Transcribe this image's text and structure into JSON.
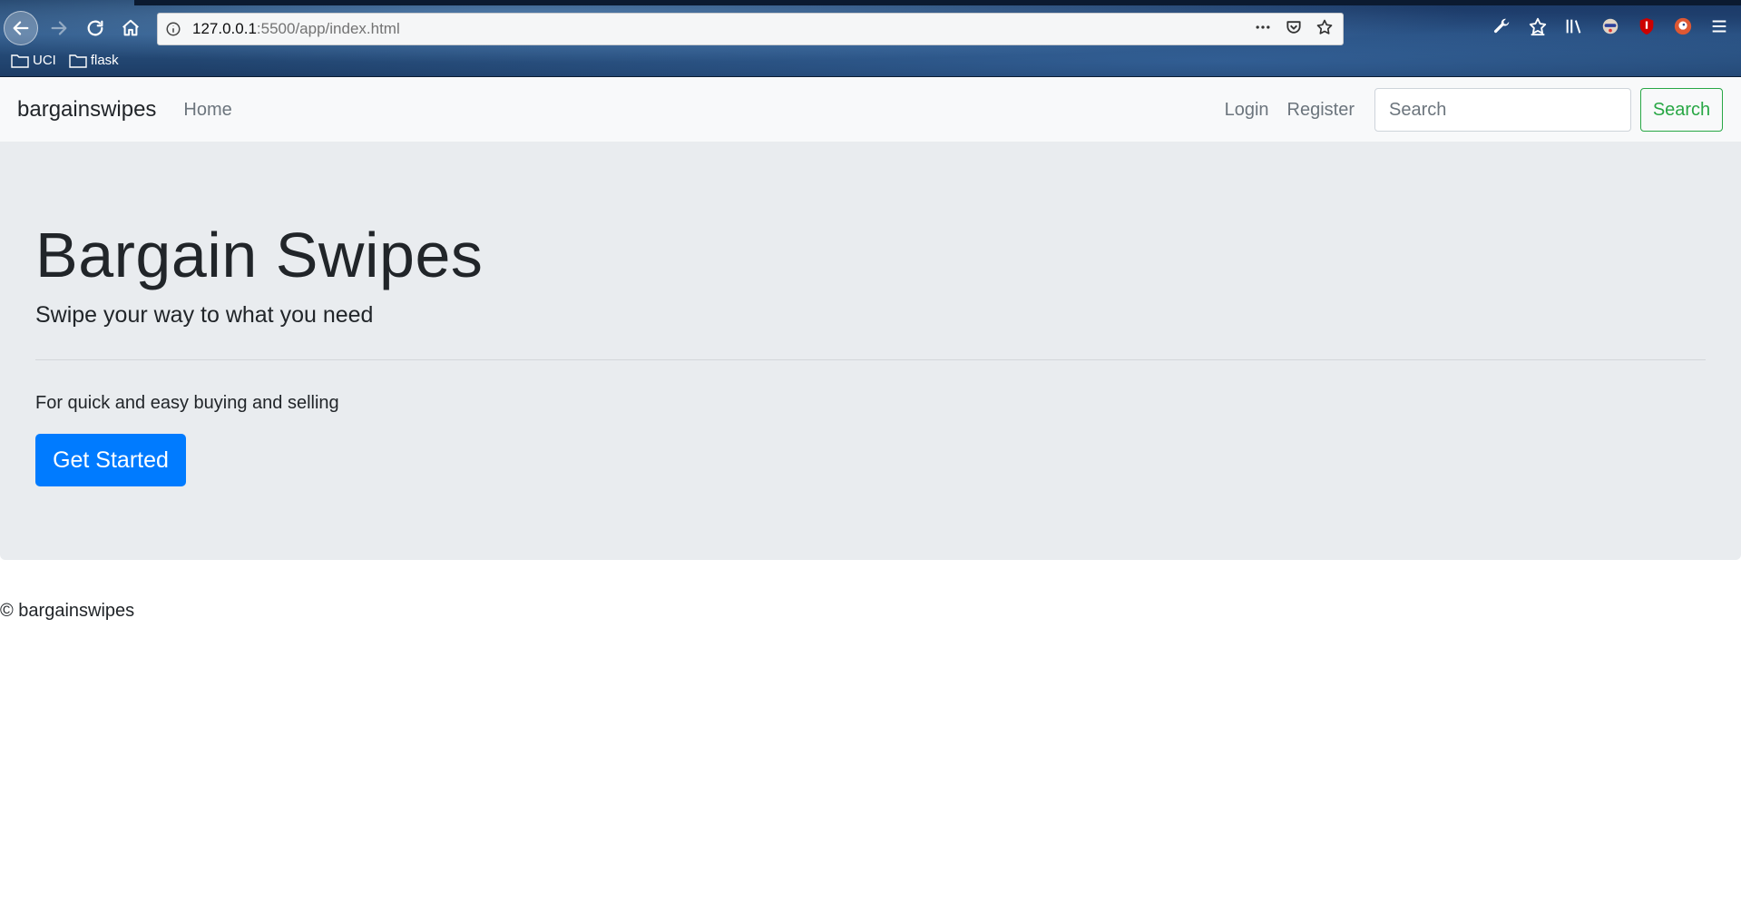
{
  "browser": {
    "url_host": "127.0.0.1",
    "url_rest": ":5500/app/index.html",
    "bookmarks": [
      {
        "label": "UCI",
        "icon": "folder-icon"
      },
      {
        "label": "flask",
        "icon": "folder-icon"
      }
    ]
  },
  "navbar": {
    "brand": "bargainswipes",
    "home": "Home",
    "login": "Login",
    "register": "Register",
    "search_placeholder": "Search",
    "search_button": "Search"
  },
  "jumbotron": {
    "title": "Bargain Swipes",
    "lead": "Swipe your way to what you need",
    "text": "For quick and easy buying and selling",
    "button": "Get Started"
  },
  "footer": {
    "text": "© bargainswipes"
  },
  "colors": {
    "primary": "#007bff",
    "success": "#28a745",
    "jumbotron_bg": "#e9ecef",
    "navbar_bg": "#f8f9fa"
  }
}
